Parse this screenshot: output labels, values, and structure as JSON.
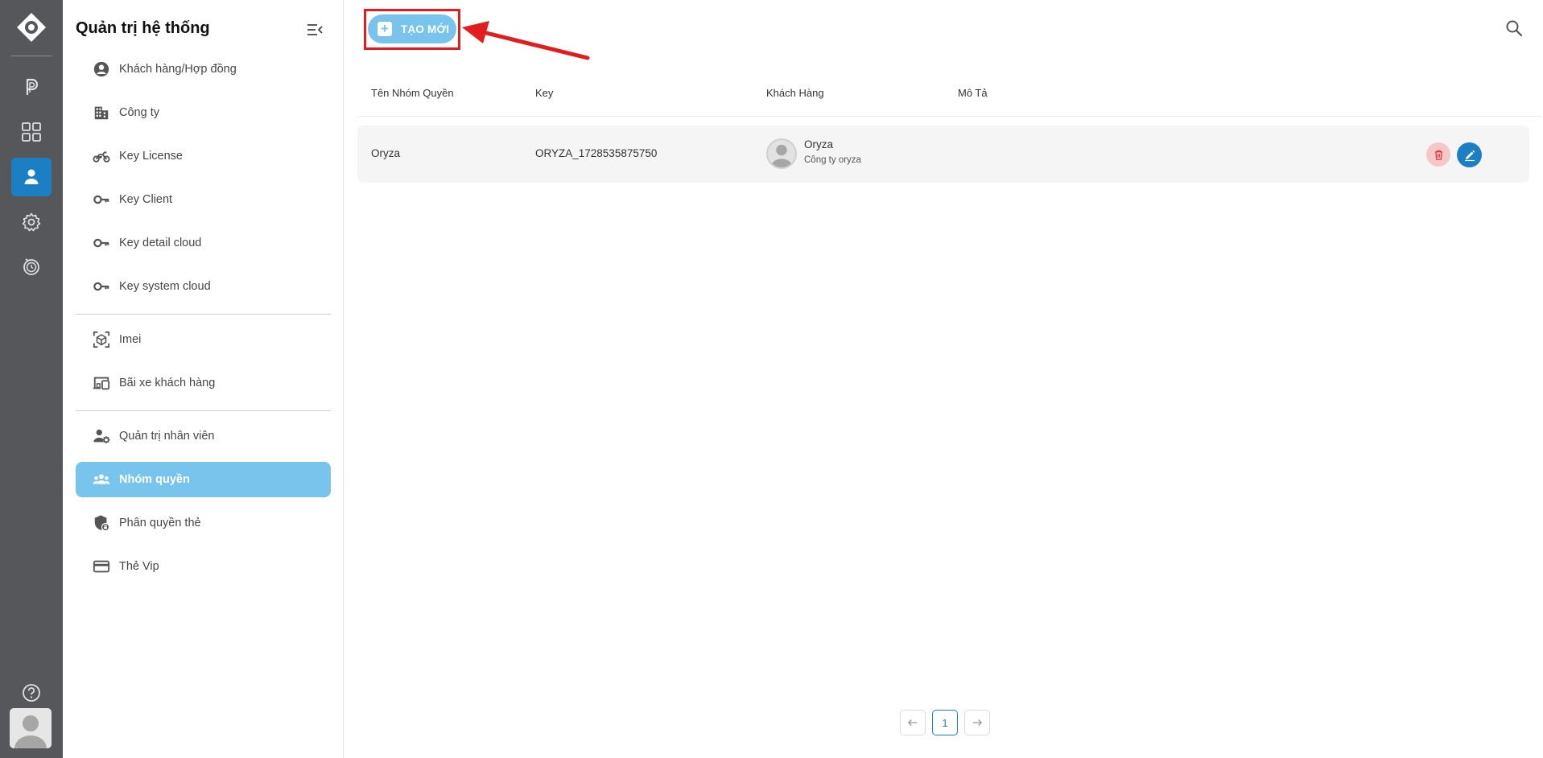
{
  "rail": {
    "items": [
      {
        "name": "parking-icon",
        "active": false
      },
      {
        "name": "dashboard-grid-icon",
        "active": false
      },
      {
        "name": "user-icon",
        "active": true
      },
      {
        "name": "gear-icon",
        "active": false
      },
      {
        "name": "history-timer-icon",
        "active": false
      }
    ],
    "accent_color": "#1c7fc4"
  },
  "sidebar": {
    "title": "Quản trị hệ thống",
    "groups": [
      {
        "items": [
          {
            "label": "Khách hàng/Hợp đồng",
            "icon": "account-circle-icon"
          },
          {
            "label": "Công ty",
            "icon": "building-icon"
          },
          {
            "label": "Key License",
            "icon": "motorbike-icon"
          },
          {
            "label": "Key Client",
            "icon": "key-icon"
          },
          {
            "label": "Key detail cloud",
            "icon": "key-icon"
          },
          {
            "label": "Key system cloud",
            "icon": "key-icon"
          }
        ]
      },
      {
        "items": [
          {
            "label": "Imei",
            "icon": "scan-cube-icon"
          },
          {
            "label": "Bãi xe khách hàng",
            "icon": "devices-icon"
          }
        ]
      },
      {
        "items": [
          {
            "label": "Quản trị nhân viên",
            "icon": "user-settings-icon"
          },
          {
            "label": "Nhóm quyền",
            "icon": "group-icon",
            "active": true
          },
          {
            "label": "Phân quyền thẻ",
            "icon": "shield-lock-icon"
          },
          {
            "label": "Thẻ Vip",
            "icon": "credit-card-icon"
          }
        ]
      }
    ],
    "active_color": "#78c4ec"
  },
  "toolbar": {
    "create_label": "TẠO MỚI",
    "create_color": "#78c4ec",
    "annotation_color": "#e21d1d"
  },
  "table": {
    "columns": [
      "Tên Nhóm Quyền",
      "Key",
      "Khách Hàng",
      "Mô Tả"
    ],
    "rows": [
      {
        "name": "Oryza",
        "key": "ORYZA_1728535875750",
        "customer_name": "Oryza",
        "customer_company": "Công ty oryza",
        "description": ""
      }
    ]
  },
  "pagination": {
    "pages": [
      "1"
    ],
    "current": "1"
  }
}
